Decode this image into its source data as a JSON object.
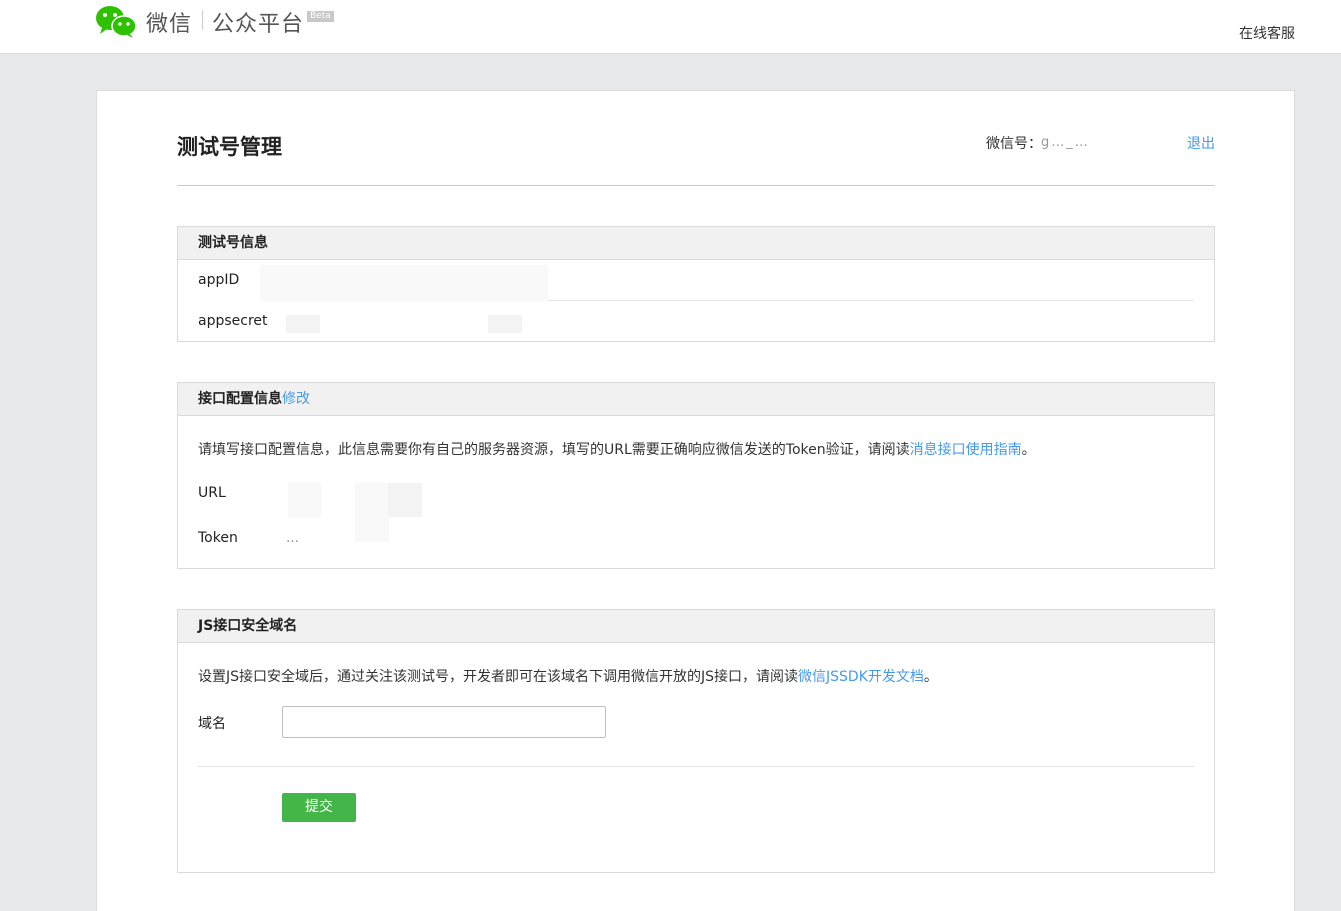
{
  "header": {
    "brand": "微信",
    "platform": "公众平台",
    "beta": "Beta",
    "service_link": "在线客服"
  },
  "page": {
    "title": "测试号管理",
    "account_label": "微信号：",
    "account_value_masked": "g…_…",
    "logout": "退出"
  },
  "test_info": {
    "title": "测试号信息",
    "appid_label": "appID",
    "appsecret_label": "appsecret"
  },
  "interface_config": {
    "title": "接口配置信息",
    "edit_link": "修改",
    "description_prefix": "请填写接口配置信息，此信息需要你有自己的服务器资源，填写的URL需要正确响应微信发送的Token验证，请阅读",
    "description_link": "消息接口使用指南",
    "description_suffix": "。",
    "url_label": "URL",
    "token_label": "Token",
    "token_partial": "…"
  },
  "js_domain": {
    "title": "JS接口安全域名",
    "description_prefix": "设置JS接口安全域后，通过关注该测试号，开发者即可在该域名下调用微信开放的JS接口，请阅读",
    "description_link": "微信JSSDK开发文档",
    "description_suffix": "。",
    "domain_label": "域名",
    "domain_value": "",
    "submit_label": "提交"
  },
  "colors": {
    "link": "#459ae9",
    "submit_button": "#44b549",
    "logo_green": "#2dc100"
  }
}
